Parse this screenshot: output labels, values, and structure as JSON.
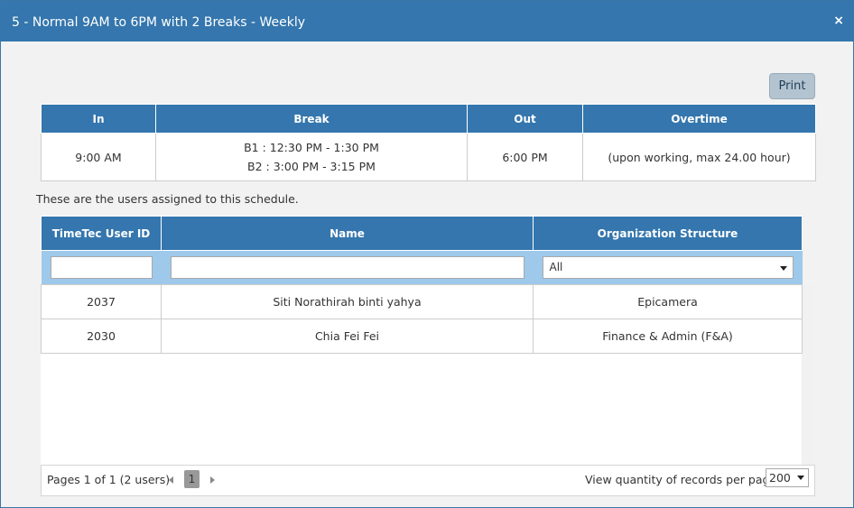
{
  "dialog": {
    "title": "5 - Normal 9AM to 6PM with 2 Breaks - Weekly",
    "close_glyph": "×",
    "print_label": "Print"
  },
  "schedule": {
    "headers": [
      "In",
      "Break",
      "Out",
      "Overtime"
    ],
    "in": "9:00 AM",
    "breaks": [
      "B1 : 12:30 PM - 1:30 PM",
      "B2 : 3:00 PM - 3:15 PM"
    ],
    "out": "6:00 PM",
    "overtime": "(upon working, max 24.00 hour)"
  },
  "assigned_note": "These are the users assigned to this schedule.",
  "users": {
    "headers": [
      "TimeTec User ID",
      "Name",
      "Organization Structure"
    ],
    "filters": {
      "user_id": "",
      "name": "",
      "org_selected": "All"
    },
    "rows": [
      {
        "id": "2037",
        "name": "Siti Norathirah binti yahya",
        "org": "Epicamera"
      },
      {
        "id": "2030",
        "name": "Chia Fei Fei",
        "org": "Finance & Admin (F&A)"
      }
    ]
  },
  "pager": {
    "summary": "Pages 1 of 1 (2 users)",
    "current_page": "1",
    "per_page_label": "View quantity of records per page",
    "per_page_value": "200"
  },
  "colors": {
    "header_blue": "#3476ad",
    "filter_row": "#9ec9eb",
    "print_button": "#b3c3d0"
  }
}
